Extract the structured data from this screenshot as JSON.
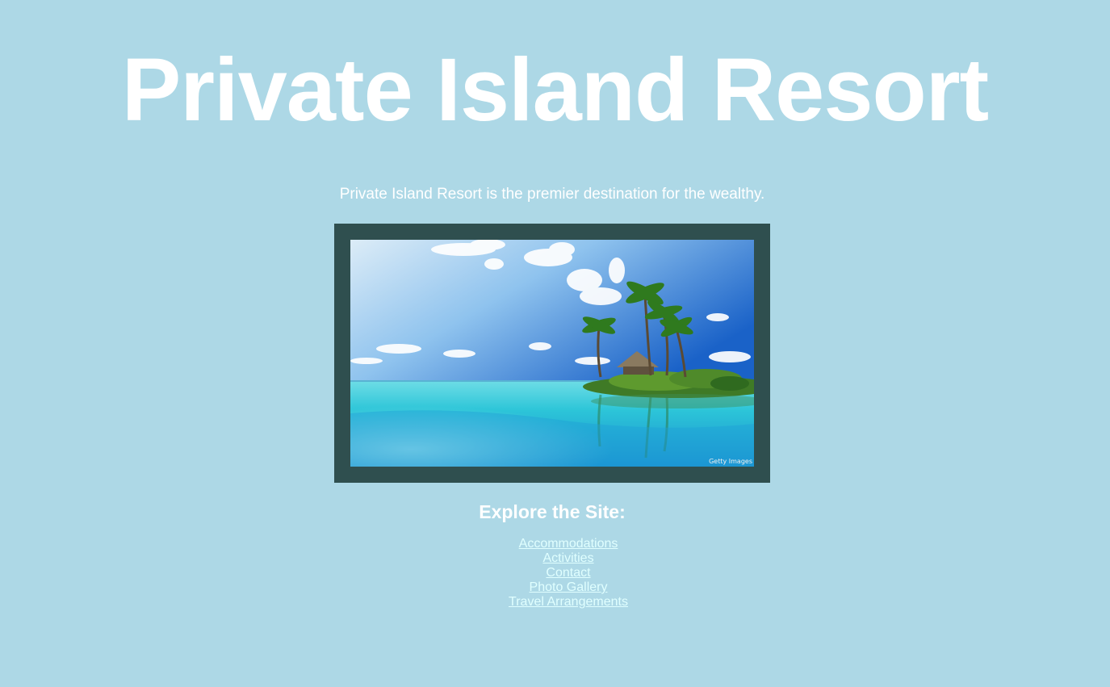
{
  "header": {
    "title": "Private Island Resort"
  },
  "intro": {
    "tagline": "Private Island Resort is the premier destination for the wealthy."
  },
  "photo": {
    "credit": "Getty Images",
    "frame_color": "#2f4f4f"
  },
  "explore": {
    "heading": "Explore the Site:",
    "links": [
      {
        "label": "Accommodations"
      },
      {
        "label": "Activities"
      },
      {
        "label": "Contact"
      },
      {
        "label": "Photo Gallery"
      },
      {
        "label": "Travel Arrangements"
      }
    ]
  },
  "colors": {
    "background": "#add8e6",
    "text": "#ffffff",
    "link": "#e0ffff"
  }
}
